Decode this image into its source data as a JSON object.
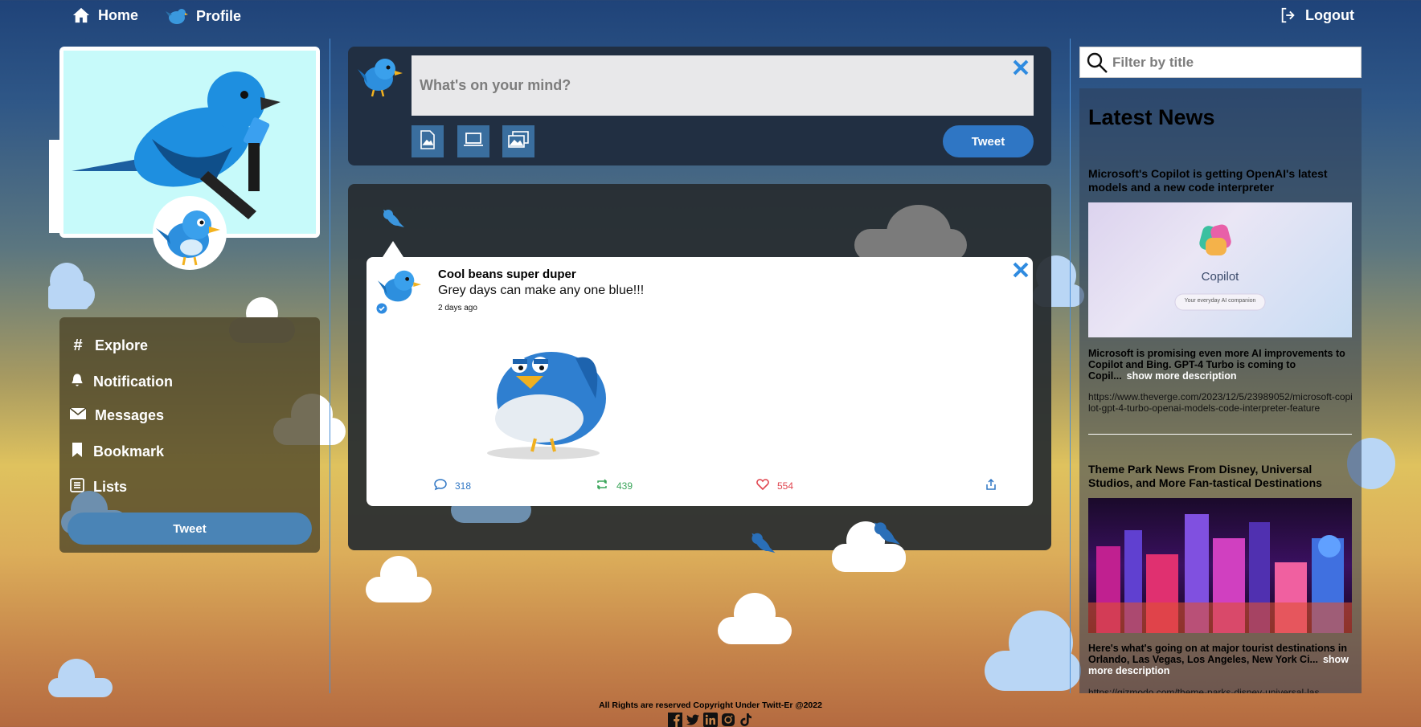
{
  "nav": {
    "home_label": "Home",
    "profile_label": "Profile",
    "logout_label": "Logout"
  },
  "sidebar": {
    "items": [
      {
        "label": "Explore",
        "icon": "hashtag-icon"
      },
      {
        "label": "Notification",
        "icon": "bell-icon"
      },
      {
        "label": "Messages",
        "icon": "envelope-icon"
      },
      {
        "label": "Bookmark",
        "icon": "bookmark-icon"
      },
      {
        "label": "Lists",
        "icon": "list-icon"
      }
    ],
    "tweet_label": "Tweet"
  },
  "composer": {
    "placeholder": "What's on your mind?",
    "tweet_label": "Tweet"
  },
  "feed": {
    "tweet": {
      "author": "Cool beans super duper",
      "text": "Grey days can make any one blue!!!",
      "time": "2 days ago",
      "replies": "318",
      "retweets": "439",
      "likes": "554"
    }
  },
  "news": {
    "search_placeholder": "Filter by title",
    "heading": "Latest News",
    "items": [
      {
        "title": "Microsoft's Copilot is getting OpenAI's latest models and a new code interpreter",
        "image_text": "Copilot",
        "image_subtext": "Your everyday AI companion",
        "description": "Microsoft is promising even more AI improvements to Copilot and Bing. GPT-4 Turbo is coming to Copil...",
        "more_label": "show more description",
        "url": "https://www.theverge.com/2023/12/5/23989052/microsoft-copilot-gpt-4-turbo-openai-models-code-interpreter-feature"
      },
      {
        "title": "Theme Park News From Disney, Universal Studios, and More Fan-tastical Destinations",
        "description": "Here's what's going on at major tourist destinations in Orlando, Las Vegas, Los Angeles, New York Ci...",
        "more_label": "show more description",
        "url": "https://gizmodo.com/theme-parks-disney-universal-las"
      }
    ]
  },
  "footer": {
    "copyright": "All Rights are reserved Copyright Under Twitt-Er @2022"
  },
  "colors": {
    "accent": "#2f76c4",
    "reply": "#2f76c4",
    "retweet": "#3aa55a",
    "like": "#e0454f"
  }
}
